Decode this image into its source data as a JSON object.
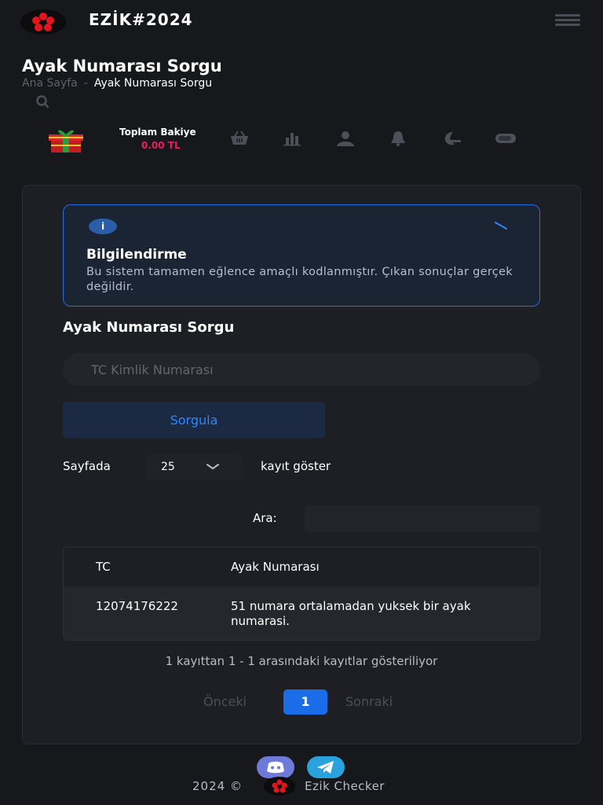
{
  "header": {
    "brand": "EZİK#2024"
  },
  "page": {
    "title": "Ayak Numarası Sorgu",
    "breadcrumb": {
      "home": "Ana Sayfa",
      "separator": "-",
      "current": "Ayak Numarası Sorgu"
    }
  },
  "balance": {
    "label": "Toplam Bakiye",
    "value": "0.00 TL"
  },
  "nav_icons": [
    "basket-icon",
    "bar-chart-icon",
    "user-icon",
    "bell-icon",
    "moon-icon",
    "toggle-icon"
  ],
  "alert": {
    "title": "Bilgilendirme",
    "text": "Bu sistem tamamen eğlence amaçlı kodlanmıştır. Çıkan sonuçlar gerçek değildir.",
    "icon": "i"
  },
  "form": {
    "section_title": "Ayak Numarası Sorgu",
    "input_placeholder": "TC Kimlik Numarası",
    "submit_label": "Sorgula"
  },
  "table_controls": {
    "length_prefix": "Sayfada",
    "length_value": "25",
    "length_suffix": "kayıt göster",
    "search_label": "Ara:"
  },
  "table": {
    "headers": [
      "TC",
      "Ayak Numarası"
    ],
    "rows": [
      [
        "12074176222",
        "51 numara ortalamadan yuksek bir ayak numarasi."
      ]
    ]
  },
  "table_info": "1 kayıttan 1 - 1 arasındaki kayıtlar gösteriliyor",
  "pagination": {
    "prev": "Önceki",
    "current": "1",
    "next": "Sonraki"
  },
  "footer": {
    "year": "2024 ©",
    "name": "Ezik Checker"
  },
  "colors": {
    "accent": "#1b6ce8",
    "balance": "#e8205a",
    "background": "#17181c"
  }
}
